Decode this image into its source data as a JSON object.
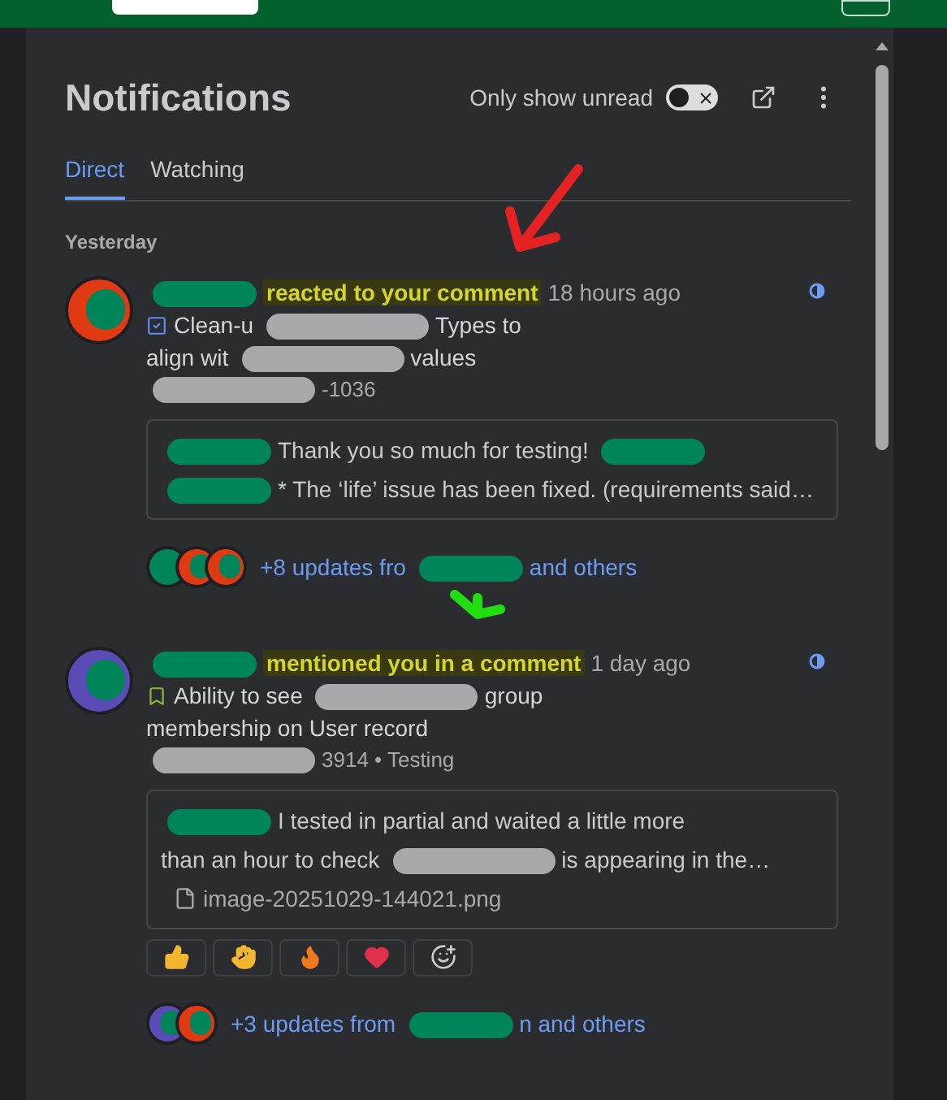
{
  "panel": {
    "title": "Notifications",
    "unread_toggle": {
      "label": "Only show unread",
      "on": false
    }
  },
  "tabs": [
    {
      "label": "Direct",
      "selected": true
    },
    {
      "label": "Watching",
      "selected": false
    }
  ],
  "group_label": "Yesterday",
  "notifications": [
    {
      "unread": true,
      "header": [
        {
          "kind": "redaction",
          "color": "#00845a"
        },
        {
          "kind": "text",
          "text": "reacted to your comment",
          "highlighted": true
        },
        {
          "kind": "text",
          "text": "18 hours ago",
          "highlighted": false
        }
      ],
      "title_lines": [
        [
          {
            "kind": "text",
            "text": "Clean-u"
          },
          {
            "kind": "redaction",
            "color": "#a8a9ad"
          },
          {
            "kind": "text",
            "text": "Types to"
          }
        ],
        [
          {
            "kind": "text",
            "text": "align wit"
          },
          {
            "kind": "redaction",
            "color": "#a8a9ad"
          },
          {
            "kind": "text",
            "text": "values"
          }
        ]
      ],
      "meta": [
        {
          "kind": "redaction",
          "color": "#a8a9ad"
        },
        {
          "kind": "text",
          "text": "-1036"
        }
      ],
      "quote_lines": [
        [
          {
            "kind": "redaction",
            "color": "#00845a"
          },
          {
            "kind": "text",
            "text": "Thank you so much for testing!"
          },
          {
            "kind": "redaction",
            "color": "#00845a"
          }
        ],
        [
          {
            "kind": "redaction",
            "color": "#00845a"
          },
          {
            "kind": "text",
            "text": "* The ‘life’ issue has been fixed. (requirements said…"
          }
        ]
      ],
      "updates": {
        "avatars": [
          {
            "color": "#00845a"
          },
          {
            "color": "#e03a12"
          },
          {
            "color": "#e03a12"
          }
        ],
        "parts": [
          {
            "kind": "text",
            "text": "+8 updates fro"
          },
          {
            "kind": "redaction",
            "color": "#00845a"
          },
          {
            "kind": "text",
            "text": "and others"
          }
        ]
      }
    },
    {
      "unread": true,
      "header": [
        {
          "kind": "redaction",
          "color": "#00845a"
        },
        {
          "kind": "text",
          "text": "mentioned you in a comment",
          "highlighted": true
        },
        {
          "kind": "text",
          "text": "1 day ago",
          "highlighted": false
        }
      ],
      "title_lines": [
        [
          {
            "kind": "text",
            "text": "Ability to see"
          },
          {
            "kind": "redaction",
            "color": "#a8a9ad"
          },
          {
            "kind": "text",
            "text": "group"
          }
        ],
        [
          {
            "kind": "text",
            "text": "membership on User record"
          }
        ]
      ],
      "meta": [
        {
          "kind": "redaction",
          "color": "#a8a9ad"
        },
        {
          "kind": "text",
          "text": "3914 • Testing"
        }
      ],
      "quote_lines": [
        [
          {
            "kind": "redaction",
            "color": "#00845a"
          },
          {
            "kind": "text",
            "text": "I tested in partial and waited a little more"
          }
        ],
        [
          {
            "kind": "text",
            "text": "than an hour to check"
          },
          {
            "kind": "redaction",
            "color": "#a8a9ad"
          },
          {
            "kind": "text",
            "text": "is appearing in the…"
          }
        ]
      ],
      "attachment": "image-20251029-144021.png",
      "reactions": [
        {
          "kind": "thumbs_up"
        },
        {
          "kind": "clap"
        },
        {
          "kind": "fire"
        },
        {
          "kind": "heart"
        },
        {
          "kind": "add"
        }
      ],
      "updates": {
        "avatars": [
          {
            "color": "#5b4bb5"
          },
          {
            "color": "#e03a12"
          }
        ],
        "parts": [
          {
            "kind": "text",
            "text": "+3 updates from"
          },
          {
            "kind": "redaction",
            "color": "#00845a"
          },
          {
            "kind": "text",
            "text": "n and others"
          }
        ]
      }
    }
  ],
  "annotations": [
    {
      "kind": "arrow",
      "color": "#e52222"
    },
    {
      "kind": "arrow",
      "color": "#22dd11"
    }
  ]
}
